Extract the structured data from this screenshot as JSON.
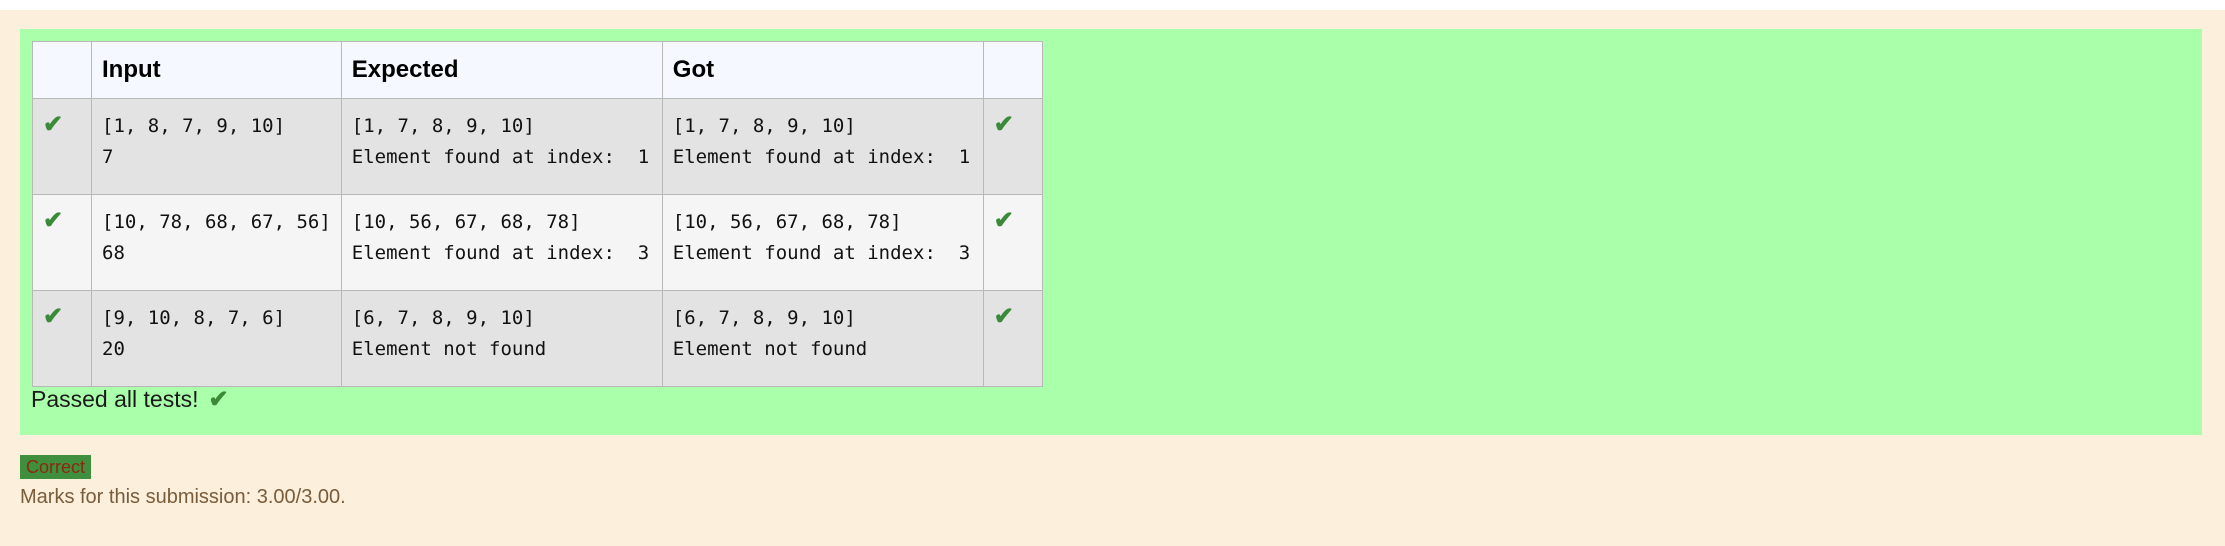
{
  "results_table": {
    "headers": [
      "",
      "Input",
      "Expected",
      "Got",
      ""
    ],
    "rows": [
      {
        "input": "[1, 8, 7, 9, 10]\n7",
        "expected": "[1, 7, 8, 9, 10]\nElement found at index:  1",
        "got": "[1, 7, 8, 9, 10]\nElement found at index:  1",
        "status": "passed"
      },
      {
        "input": "[10, 78, 68, 67, 56]\n68",
        "expected": "[10, 56, 67, 68, 78]\nElement found at index:  3",
        "got": "[10, 56, 67, 68, 78]\nElement found at index:  3",
        "status": "passed"
      },
      {
        "input": "[9, 10, 8, 7, 6]\n20",
        "expected": "[6, 7, 8, 9, 10]\nElement not found",
        "got": "[6, 7, 8, 9, 10]\nElement not found",
        "status": "passed"
      }
    ]
  },
  "summary": {
    "pass_message": "Passed all tests!",
    "check_glyph": "✔"
  },
  "grading": {
    "badge_label": "Correct",
    "marks_text": "Marks for this submission: 3.00/3.00."
  },
  "colors": {
    "page_background": "#fcefdc",
    "result_background": "#aaffaa",
    "check_color": "#3a8a3a",
    "badge_background": "#3f8f3f"
  }
}
